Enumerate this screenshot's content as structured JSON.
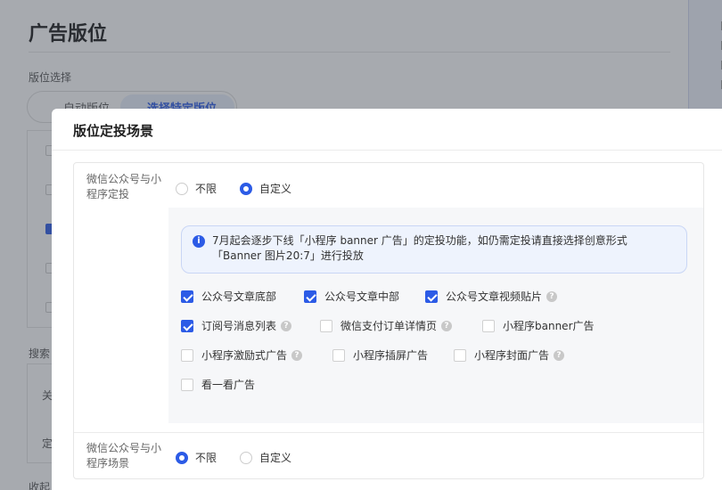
{
  "background": {
    "title": "广告版位",
    "section_label": "版位选择",
    "seg_auto": "自动版位",
    "seg_specific": "选择特定版位",
    "search_label": "搜索",
    "side_label_1": "关",
    "side_label_2": "定",
    "collapse_label": "收起"
  },
  "modal": {
    "title": "版位定投场景",
    "row1": {
      "label": "微信公众号与小程序定投",
      "options": [
        "不限",
        "自定义"
      ],
      "selected": "自定义"
    },
    "notice": "7月起会逐步下线「小程序 banner 广告」的定投功能，如仍需定投请直接选择创意形式「Banner 图片20:7」进行投放",
    "checkboxes": [
      {
        "label": "公众号文章底部",
        "checked": true,
        "help": false
      },
      {
        "label": "公众号文章中部",
        "checked": true,
        "help": false
      },
      {
        "label": "公众号文章视频贴片",
        "checked": true,
        "help": true
      },
      {
        "label": "订阅号消息列表",
        "checked": true,
        "help": true
      },
      {
        "label": "微信支付订单详情页",
        "checked": false,
        "help": true
      },
      {
        "label": "小程序banner广告",
        "checked": false,
        "help": false
      },
      {
        "label": "小程序激励式广告",
        "checked": false,
        "help": true
      },
      {
        "label": "小程序插屏广告",
        "checked": false,
        "help": false
      },
      {
        "label": "小程序封面广告",
        "checked": false,
        "help": true
      },
      {
        "label": "看一看广告",
        "checked": false,
        "help": false
      }
    ],
    "row2": {
      "label": "微信公众号与小程序场景",
      "options": [
        "不限",
        "自定义"
      ],
      "selected": "不限"
    }
  },
  "colors": {
    "accent": "#2c5be6"
  }
}
